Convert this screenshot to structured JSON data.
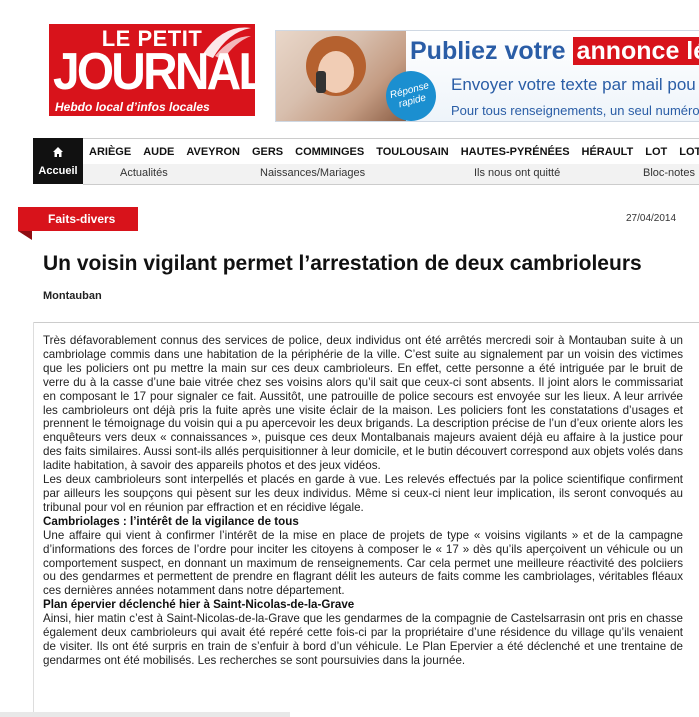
{
  "logo": {
    "top": "LE PETIT",
    "main": "JOURNAL",
    "tagline": "Hebdo local d’infos locales"
  },
  "banner": {
    "line1_prefix": "Publiez votre ",
    "line1_highlight": "annonce lé",
    "line2": "Envoyer votre texte par mail pou",
    "line3": "Pour tous renseignements, un seul numéro",
    "badge": "Réponse rapide"
  },
  "nav": {
    "home_label": "Accueil",
    "departments": [
      "ARIÈGE",
      "AUDE",
      "AVEYRON",
      "GERS",
      "COMMINGES",
      "TOULOUSAIN",
      "HAUTES-PYRÉNÉES",
      "HÉRAULT",
      "LOT",
      "LOT-ET-G"
    ],
    "sub": [
      "Actualités",
      "Naissances/Mariages",
      "Ils nous ont quitté",
      "Bloc-notes"
    ]
  },
  "article": {
    "category": "Faits-divers",
    "date": "27/04/2014",
    "title": "Un voisin vigilant permet l’arrestation de deux cambrioleurs",
    "location": "Montauban",
    "p1": "Très défavorablement connus des services de police, deux individus ont été arrêtés mercredi soir à Montauban suite à un cambriolage commis dans une habitation de la périphérie de la ville. C’est suite au signalement par un voisin des victimes que les policiers ont pu mettre la main sur ces deux cambrioleurs. En effet, cette personne a été intriguée par le bruit de verre du à la casse d’une baie vitrée chez ses voisins alors qu’il sait que ceux-ci sont absents. Il joint alors le commissariat en composant le 17 pour signaler ce fait. Aussitôt, une patrouille de police secours est envoyée sur les lieux. A leur arrivée les cambrioleurs ont déjà pris la fuite après une visite éclair de la maison. Les policiers font les constatations d’usages et prennent le témoignage du voisin qui a pu apercevoir les deux brigands. La description précise de l’un d’eux oriente alors les enquêteurs vers deux « connaissances », puisque ces deux Montalbanais majeurs avaient déjà eu affaire à la justice pour des faits similaires. Aussi sont-ils allés perquisitionner à leur domicile, et le butin découvert correspond aux objets volés dans ladite habitation, à savoir des appareils photos et des jeux vidéos.",
    "p2": "Les deux cambrioleurs sont interpellés et placés en garde à vue. Les relevés effectués par la police scientifique confirment par ailleurs les soupçons qui pèsent sur les deux individus. Même si ceux-ci nient leur implication, ils seront convoqués au tribunal pour vol en réunion par effraction et en récidive légale.",
    "h1": "Cambriolages : l’intérêt de la vigilance de tous",
    "p3": "Une affaire qui vient à confirmer l’intérêt de la mise en place de projets de type « voisins vigilants » et de la campagne d’informations des forces de l’ordre pour inciter les citoyens à composer le « 17 » dès qu’ils aperçoivent un véhicule ou un comportement suspect, en donnant un maximum de renseignements. Car cela permet une meilleure réactivité des polciiers ou des gendarmes et permettent de prendre en flagrant délit les auteurs de faits comme les cambriolages, véritables fléaux ces dernières années notamment dans notre département.",
    "h2": "Plan épervier déclenché hier à Saint-Nicolas-de-la-Grave",
    "p4": "Ainsi, hier matin c’est à Saint-Nicolas-de-la-Grave que les gendarmes de la compagnie de Castelsarrasin ont pris en chasse également deux cambrioleurs qui avait été repéré cette fois-ci par la propriétaire d’une résidence du village qu’ils venaient de visiter. Ils ont été surpris en train de s’enfuir à bord d’un véhicule. Le Plan Epervier a été déclenché et une trentaine de gendarmes ont été mobilisés. Les recherches se sont poursuivies dans la journée."
  },
  "colors": {
    "brand_red": "#d8131b",
    "nav_dark": "#111111",
    "banner_blue": "#2a5da6"
  }
}
